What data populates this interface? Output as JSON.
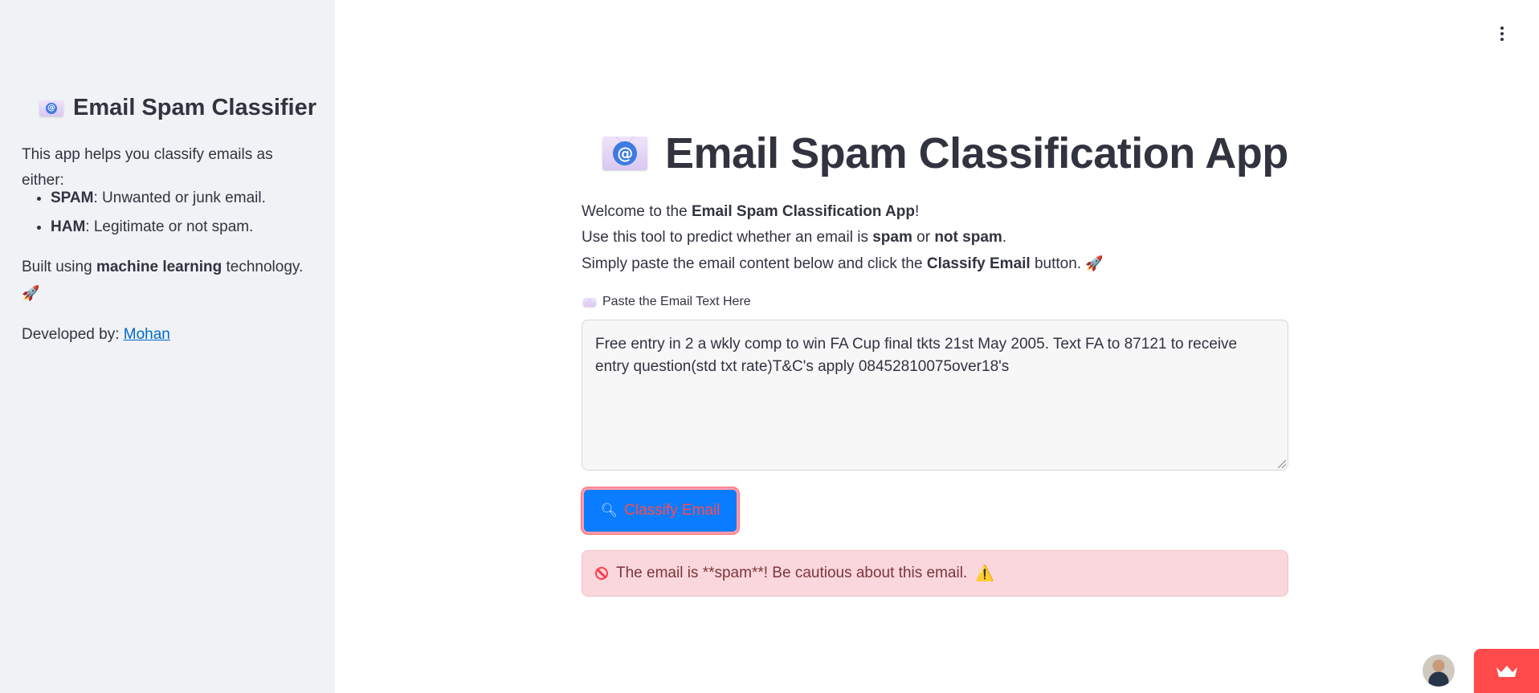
{
  "sidebar": {
    "title": "Email Spam Classifier",
    "intro": "This app helps you classify emails as either:",
    "items": [
      {
        "term": "SPAM",
        "desc": ": Unwanted or junk email."
      },
      {
        "term": "HAM",
        "desc": ": Legitimate or not spam."
      }
    ],
    "built_prefix": "Built using ",
    "built_bold": "machine learning",
    "built_suffix": " technology.",
    "rocket": "🚀",
    "dev_prefix": "Developed by: ",
    "dev_link": "Mohan"
  },
  "main": {
    "title": "Email Spam Classification App",
    "intro": {
      "l1_prefix": "Welcome to the ",
      "l1_bold": "Email Spam Classification App",
      "l1_suffix": "!",
      "l2_prefix": "Use this tool to predict whether an email is ",
      "l2_bold1": "spam",
      "l2_mid": " or ",
      "l2_bold2": "not spam",
      "l2_suffix": ".",
      "l3_prefix": "Simply paste the email content below and click the ",
      "l3_bold": "Classify Email",
      "l3_suffix": " button. ",
      "l3_rocket": "🚀"
    },
    "field_label": "Paste the Email Text Here",
    "email_text": "Free entry in 2 a wkly comp to win FA Cup final tkts 21st May 2005. Text FA to 87121 to receive entry question(std txt rate)T&C's apply 08452810075over18's",
    "classify_button": "Classify Email",
    "result": "The email is **spam**! Be cautious about this email.",
    "result_warn": "⚠️"
  },
  "colors": {
    "sidebar_bg": "#f0f2f6",
    "button_bg": "#0a7cff",
    "button_text": "#ff4b4b",
    "alert_bg": "#f9d7dc",
    "link": "#0068c9",
    "badge": "#ff4b4b"
  }
}
